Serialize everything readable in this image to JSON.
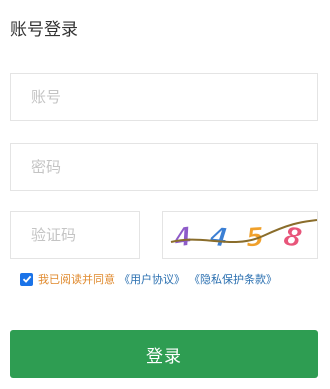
{
  "title": "账号登录",
  "account": {
    "placeholder": "账号",
    "value": ""
  },
  "password": {
    "placeholder": "密码",
    "value": ""
  },
  "code": {
    "placeholder": "验证码",
    "value": ""
  },
  "captcha": {
    "text": "4458",
    "chars": [
      "4",
      "4",
      "5",
      "8"
    ],
    "colors": [
      "#8e5bc9",
      "#3b7fd4",
      "#f0a02a",
      "#e8557a"
    ]
  },
  "agreement": {
    "checked": true,
    "text": "我已阅读并同意",
    "user_agreement": "《用户协议》",
    "privacy_terms": "《隐私保护条款》"
  },
  "login_button": {
    "label": "登录"
  },
  "colors": {
    "primary": "#2e9d52",
    "checkbox": "#1a73e8",
    "agree_text": "#e08a2e",
    "link": "#2a6fb0"
  }
}
